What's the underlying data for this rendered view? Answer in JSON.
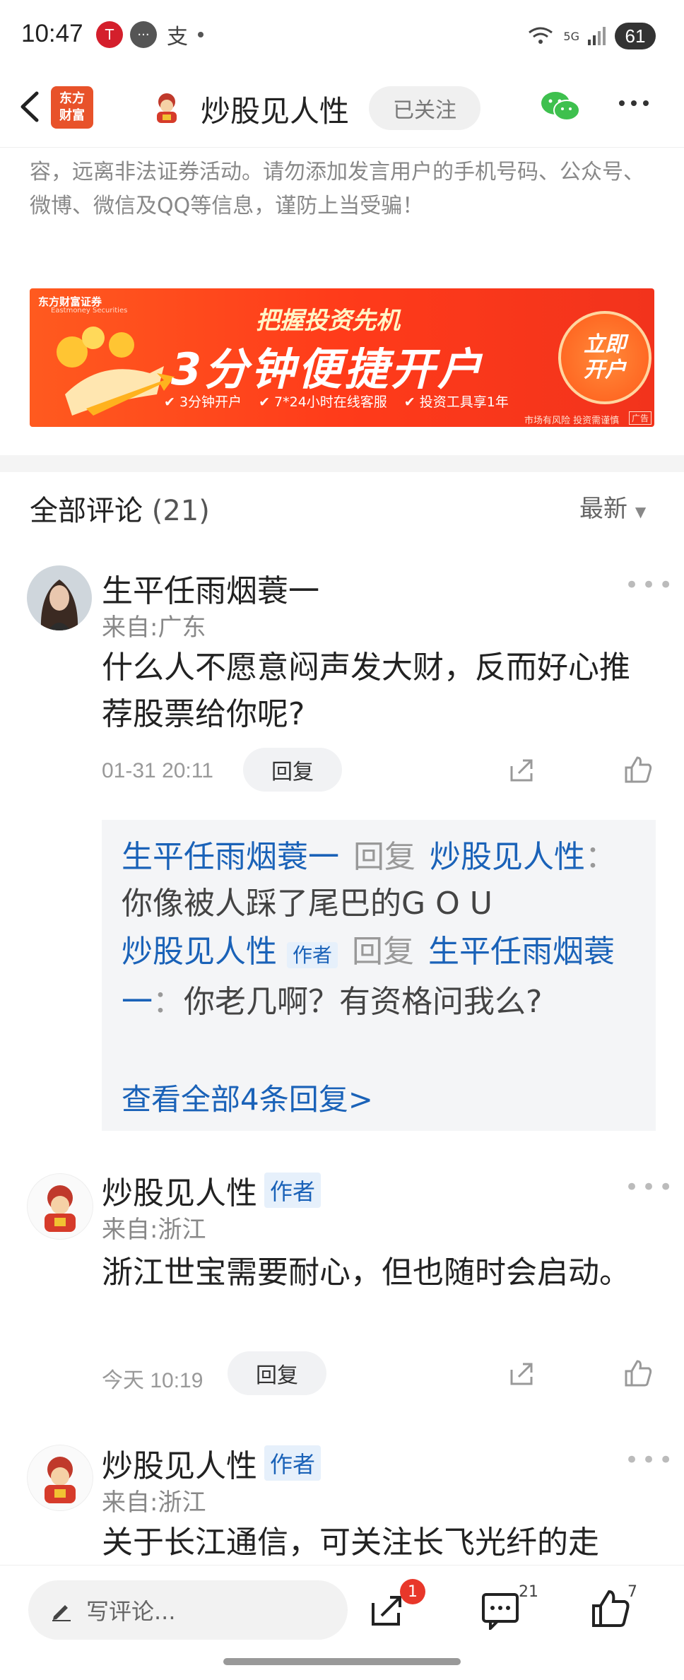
{
  "status": {
    "time": "10:47",
    "battery": "61",
    "net": "5G"
  },
  "header": {
    "logo_line1": "东方",
    "logo_line2": "财富",
    "title": "炒股见人性",
    "follow_label": "已关注"
  },
  "disclaimer": "操作风险自担。请勿相信代客理财、免费荐股和炒股培训等宣传内容，远离非法证券活动。请勿添加发言用户的手机号码、公众号、微博、微信及QQ等信息，谨防上当受骗！",
  "banner": {
    "brand": "东方财富证券",
    "brand_en": "Eastmoney Securities",
    "headline": "把握投资先机",
    "main": "3分钟便捷开户",
    "features": [
      "3分钟开户",
      "7*24小时在线客服",
      "投资工具享1年"
    ],
    "cta_line1": "立即",
    "cta_line2": "开户",
    "note": "市场有风险 投资需谨慎",
    "ad_tag": "广告"
  },
  "comments": {
    "title": "全部评论",
    "count": "(21)",
    "sort": "最新",
    "items": [
      {
        "user": "生平任雨烟蓑一",
        "from": "来自:广东",
        "text": "什么人不愿意闷声发大财，反而好心推荐股票给你呢?",
        "time": "01-31 20:11",
        "reply_label": "回复",
        "replies": [
          {
            "from_user": "生平任雨烟蓑一",
            "verb": "回复",
            "to_user": "炒股见人性",
            "colon": "：",
            "text": "你像被人踩了尾巴的G O U"
          },
          {
            "from_user": "炒股见人性",
            "tag": "作者",
            "verb": "回复",
            "to_user": "生平任雨烟蓑一",
            "colon": "：",
            "text": "你老几啊？有资格问我么?"
          }
        ],
        "view_all": "查看全部4条回复>"
      },
      {
        "user": "炒股见人性",
        "tag": "作者",
        "from": "来自:浙江",
        "text": "浙江世宝需要耐心，但也随时会启动。",
        "time": "今天 10:19",
        "reply_label": "回复"
      },
      {
        "user": "炒股见人性",
        "tag": "作者",
        "from": "来自:浙江",
        "text": "关于长江通信，可关注长飞光纤的走"
      }
    ]
  },
  "bottom": {
    "write_placeholder": "写评论...",
    "share_badge": "1",
    "comment_count": "21",
    "like_count": "7"
  },
  "colors": {
    "brand_red": "#e8522a",
    "link_blue": "#1a62b8",
    "banner_orange": "#ff4a1c"
  }
}
